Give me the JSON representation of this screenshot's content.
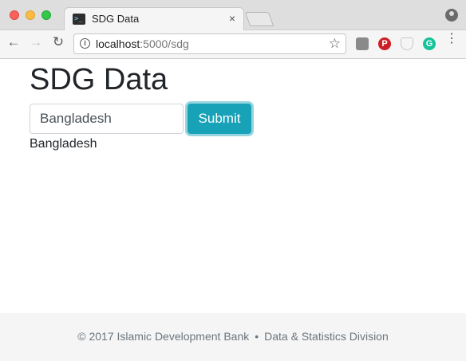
{
  "browser": {
    "tab": {
      "title": "SDG Data",
      "close": "×"
    },
    "url": {
      "host": "localhost",
      "path": ":5000/sdg"
    },
    "nav": {
      "back": "←",
      "forward": "→",
      "reload": "↻"
    },
    "star": "☆",
    "menu": "⋮",
    "extensions": [
      "square-extension-icon",
      "pinterest-icon",
      "shield-extension-icon",
      "grammarly-icon"
    ],
    "extension_glyphs": {
      "pinterest": "P",
      "grammarly": "G"
    }
  },
  "page": {
    "title": "SDG Data",
    "search": {
      "value": "Bangladesh",
      "placeholder": ""
    },
    "submit_label": "Submit",
    "result": "Bangladesh"
  },
  "footer": {
    "copyright": "© 2017 Islamic Development Bank",
    "separator": "•",
    "division": "Data & Statistics Division"
  },
  "colors": {
    "accent": "#17a2b8",
    "text": "#212529",
    "footer_bg": "#f5f5f5",
    "footer_text": "#6c757d"
  }
}
